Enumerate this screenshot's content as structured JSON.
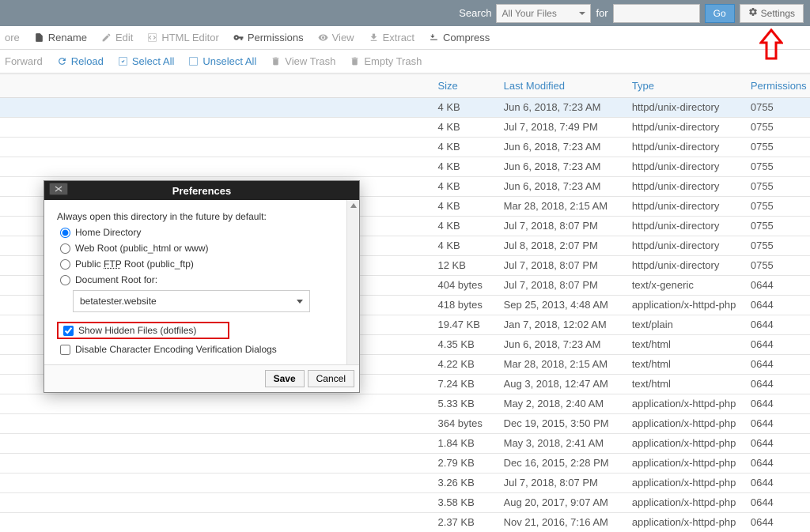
{
  "topbar": {
    "search_label": "Search",
    "select_value": "All Your Files",
    "for_label": "for",
    "go_label": "Go",
    "settings_label": "Settings"
  },
  "toolbar1": {
    "restore": "ore",
    "rename": "Rename",
    "edit": "Edit",
    "html_editor": "HTML Editor",
    "permissions": "Permissions",
    "view": "View",
    "extract": "Extract",
    "compress": "Compress"
  },
  "toolbar2": {
    "forward": "Forward",
    "reload": "Reload",
    "select_all": "Select All",
    "unselect_all": "Unselect All",
    "view_trash": "View Trash",
    "empty_trash": "Empty Trash"
  },
  "table": {
    "headers": {
      "size": "Size",
      "last_modified": "Last Modified",
      "type": "Type",
      "permissions": "Permissions"
    },
    "rows": [
      {
        "size": "4 KB",
        "mod": "Jun 6, 2018, 7:23 AM",
        "type": "httpd/unix-directory",
        "perm": "0755",
        "sel": true
      },
      {
        "size": "4 KB",
        "mod": "Jul 7, 2018, 7:49 PM",
        "type": "httpd/unix-directory",
        "perm": "0755"
      },
      {
        "size": "4 KB",
        "mod": "Jun 6, 2018, 7:23 AM",
        "type": "httpd/unix-directory",
        "perm": "0755"
      },
      {
        "size": "4 KB",
        "mod": "Jun 6, 2018, 7:23 AM",
        "type": "httpd/unix-directory",
        "perm": "0755"
      },
      {
        "size": "4 KB",
        "mod": "Jun 6, 2018, 7:23 AM",
        "type": "httpd/unix-directory",
        "perm": "0755"
      },
      {
        "size": "4 KB",
        "mod": "Mar 28, 2018, 2:15 AM",
        "type": "httpd/unix-directory",
        "perm": "0755"
      },
      {
        "size": "4 KB",
        "mod": "Jul 7, 2018, 8:07 PM",
        "type": "httpd/unix-directory",
        "perm": "0755"
      },
      {
        "size": "4 KB",
        "mod": "Jul 8, 2018, 2:07 PM",
        "type": "httpd/unix-directory",
        "perm": "0755"
      },
      {
        "size": "12 KB",
        "mod": "Jul 7, 2018, 8:07 PM",
        "type": "httpd/unix-directory",
        "perm": "0755"
      },
      {
        "size": "404 bytes",
        "mod": "Jul 7, 2018, 8:07 PM",
        "type": "text/x-generic",
        "perm": "0644"
      },
      {
        "size": "418 bytes",
        "mod": "Sep 25, 2013, 4:48 AM",
        "type": "application/x-httpd-php",
        "perm": "0644"
      },
      {
        "size": "19.47 KB",
        "mod": "Jan 7, 2018, 12:02 AM",
        "type": "text/plain",
        "perm": "0644"
      },
      {
        "size": "4.35 KB",
        "mod": "Jun 6, 2018, 7:23 AM",
        "type": "text/html",
        "perm": "0644"
      },
      {
        "size": "4.22 KB",
        "mod": "Mar 28, 2018, 2:15 AM",
        "type": "text/html",
        "perm": "0644"
      },
      {
        "size": "7.24 KB",
        "mod": "Aug 3, 2018, 12:47 AM",
        "type": "text/html",
        "perm": "0644"
      },
      {
        "size": "5.33 KB",
        "mod": "May 2, 2018, 2:40 AM",
        "type": "application/x-httpd-php",
        "perm": "0644"
      },
      {
        "size": "364 bytes",
        "mod": "Dec 19, 2015, 3:50 PM",
        "type": "application/x-httpd-php",
        "perm": "0644"
      },
      {
        "size": "1.84 KB",
        "mod": "May 3, 2018, 2:41 AM",
        "type": "application/x-httpd-php",
        "perm": "0644"
      },
      {
        "size": "2.79 KB",
        "mod": "Dec 16, 2015, 2:28 PM",
        "type": "application/x-httpd-php",
        "perm": "0644"
      },
      {
        "size": "3.26 KB",
        "mod": "Jul 7, 2018, 8:07 PM",
        "type": "application/x-httpd-php",
        "perm": "0644"
      },
      {
        "size": "3.58 KB",
        "mod": "Aug 20, 2017, 9:07 AM",
        "type": "application/x-httpd-php",
        "perm": "0644"
      },
      {
        "size": "2.37 KB",
        "mod": "Nov 21, 2016, 7:16 AM",
        "type": "application/x-httpd-php",
        "perm": "0644"
      }
    ]
  },
  "dialog": {
    "title": "Preferences",
    "always_open": "Always open this directory in the future by default:",
    "home_dir": "Home Directory",
    "web_root": "Web Root (public_html or www)",
    "public_ftp_pre": "Public ",
    "public_ftp_u": "FTP",
    "public_ftp_post": " Root (public_ftp)",
    "doc_root": "Document Root for:",
    "doc_root_value": "betatester.website",
    "show_hidden": "Show Hidden Files (dotfiles)",
    "disable_enc": "Disable Character Encoding Verification Dialogs",
    "save": "Save",
    "cancel": "Cancel"
  }
}
